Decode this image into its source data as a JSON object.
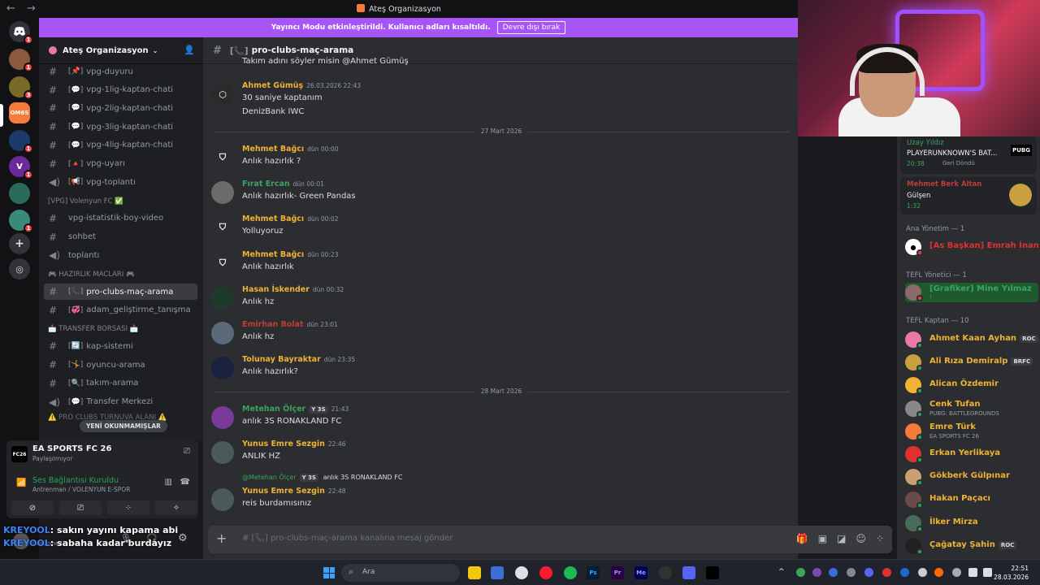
{
  "window": {
    "title": "Ateş Organizasyon",
    "back": "←",
    "forward": "→"
  },
  "banner": {
    "text": "Yayıncı Modu etkinleştirildi. Kullanıcı adları kısaltıldı.",
    "button": "Devre dışı bırak"
  },
  "guilds": [
    {
      "badge": "1"
    },
    {
      "badge": "1"
    },
    {
      "badge": "3"
    },
    {
      "label": "OM6S"
    },
    {
      "badge": "1"
    },
    {
      "badge": "1"
    },
    {
      "badge": ""
    },
    {
      "badge": "1"
    }
  ],
  "server": {
    "name": "Ateş Organizasyon"
  },
  "channels": [
    {
      "emoji": "[📌]",
      "name": "vpg-duyuru",
      "type": "announce"
    },
    {
      "emoji": "[💬]",
      "name": "vpg-1lig-kaptan-chati",
      "type": "text"
    },
    {
      "emoji": "[💬]",
      "name": "vpg-2lig-kaptan-chati",
      "type": "text"
    },
    {
      "emoji": "[💬]",
      "name": "vpg-3lig-kaptan-chati",
      "type": "text"
    },
    {
      "emoji": "[💬]",
      "name": "vpg-4lig-kaptan-chati",
      "type": "text"
    },
    {
      "emoji": "[🔺]",
      "name": "vpg-uyarı",
      "type": "text"
    },
    {
      "emoji": "[📢]",
      "name": "vpg-toplantı",
      "type": "voice"
    }
  ],
  "category1": "[VPG] Volenyun FC ✅",
  "channels2": [
    {
      "name": "vpg-istatistik-boy-video",
      "type": "text"
    },
    {
      "name": "sohbet",
      "type": "text"
    },
    {
      "name": "toplantı",
      "type": "voice"
    }
  ],
  "category2": "🎮 HAZIRLIK MACLARI 🎮",
  "channels3": [
    {
      "emoji": "[📞]",
      "name": "pro-clubs-maç-arama",
      "type": "text"
    },
    {
      "emoji": "[💞]",
      "name": "adam_geliştirme_tanışma",
      "type": "text"
    }
  ],
  "category3": "📩 TRANSFER BORSASI 📩",
  "channels4": [
    {
      "emoji": "[🔄]",
      "name": "kap-sistemi",
      "type": "text"
    },
    {
      "emoji": "[🤸]",
      "name": "oyuncu-arama",
      "type": "text"
    },
    {
      "emoji": "[🔍]",
      "name": "takım-arama",
      "type": "text"
    },
    {
      "emoji": "[💬]",
      "name": "Transfer Merkezi",
      "type": "voice"
    }
  ],
  "category4": "⚠️ PRO CLUBS TURNUVA ALANI ⚠️",
  "unread": "YENİ OKUNMAMIŞLAR",
  "panel": {
    "game": "EA SPORTS FC 26",
    "game_status": "Paylaşılmıyor",
    "game_logo": "FC26",
    "voice": "Ses Bağlantısı Kuruldu",
    "voice_sub": "Antrenman / VOLENYUN E-SPOR",
    "user_status": "Görünmez"
  },
  "overlay": [
    {
      "user": "KREYOOL",
      "text": ": sakın yayını kapama abi"
    },
    {
      "user": "KREYOOL",
      "text": ": sabaha kadar burdayız"
    }
  ],
  "channel_header": {
    "name": "pro-clubs-maç-arama",
    "emoji": "[📞]"
  },
  "messages": {
    "top_partial": "Takım adını söyler misin @Ahmet Gümüş",
    "m1": {
      "name": "Ahmet Gümüş",
      "time": "26.03.2026 22:43",
      "text": "30 saniye kaptanım",
      "text2": "DenizBank IWC",
      "color": "#f0b232"
    },
    "sep1": "27 Mart 2026",
    "m2": {
      "name": "Mehmet Bağcı",
      "time": "dün 00:00",
      "text": "Anlık hazırlık ?",
      "color": "#f0b232"
    },
    "m3": {
      "name": "Fırat Ercan",
      "time": "dün 00:01",
      "text": "Anlık hazırlık- Green Pandas",
      "color": "#3ba55d"
    },
    "m4": {
      "name": "Mehmet Bağcı",
      "time": "dün 00:02",
      "text": "Yolluyoruz",
      "color": "#f0b232"
    },
    "m5": {
      "name": "Mehmet Bağcı",
      "time": "dün 00:23",
      "text": "Anlık hazırlık",
      "color": "#f0b232"
    },
    "m6": {
      "name": "Hasan İskender",
      "time": "dün 00:32",
      "text": "Anlık hz",
      "color": "#f0b232"
    },
    "m7": {
      "name": "Emirhan Bolat",
      "time": "dün 23:01",
      "text": "Anlık hz",
      "color": "#c23b3b"
    },
    "m8": {
      "name": "Tolunay Bayraktar",
      "time": "dün 23:35",
      "text": "Anlık hazırlık?",
      "color": "#f0b232"
    },
    "sep2": "28 Mart 2026",
    "m9": {
      "name": "Metehan Ölçer",
      "tag": "Y 3S",
      "time": "21:43",
      "text": "anlık 3S RONAKLAND FC",
      "color": "#3ba55d"
    },
    "m10": {
      "name": "Yunus Emre Sezgin",
      "time": "22:46",
      "text": "ANLIK HZ",
      "color": "#f0b232"
    },
    "reply": {
      "name": "@Metehan Ölçer",
      "tag": "Y 3S",
      "text": "anlık 3S RONAKLAND FC"
    },
    "m11": {
      "name": "Yunus Emre Sezgin",
      "time": "22:48",
      "text": "reis burdamısınız",
      "color": "#f0b232"
    }
  },
  "composer": {
    "placeholder": "# [📞] pro-clubs-maç-arama kanalına mesaj gönder"
  },
  "members": {
    "card1": {
      "name": "Uzay Yıldız",
      "game": "PLAYERUNKNOWN'S BAT...",
      "meta": "20:38",
      "meta2": "Geri Döndü",
      "logo": "PUBG"
    },
    "card2": {
      "name": "Mehmet Berk Altan",
      "song": "Gülşen",
      "time": "1:32"
    },
    "cat1": "Ana Yönetim — 1",
    "u1": {
      "name": "[As Başkan] Emrah İnan",
      "color": "#e03131"
    },
    "cat2": "TEFL Yönetici — 1",
    "u2": {
      "name": "[Grafiker] Mine Yılmaz",
      "sub": "!",
      "color": "#3ba55d"
    },
    "cat3": "TEFL Kaptan — 10",
    "kaptan": [
      {
        "name": "Ahmet Kaan Ayhan",
        "tag": "ROC",
        "sub": ""
      },
      {
        "name": "Ali Rıza Demiralp",
        "tag": "BRFC",
        "sub": ""
      },
      {
        "name": "Alican Özdemir",
        "tag": "",
        "sub": ""
      },
      {
        "name": "Cenk Tufan",
        "tag": "",
        "sub": "PUBG: BATTLEGROUNDS"
      },
      {
        "name": "Emre Türk",
        "tag": "",
        "sub": "EA SPORTS FC 26"
      },
      {
        "name": "Erkan Yerlikaya",
        "tag": "",
        "sub": ""
      },
      {
        "name": "Gökberk Gülpınar",
        "tag": "",
        "sub": ""
      },
      {
        "name": "Hakan Paçacı",
        "tag": "",
        "sub": ""
      },
      {
        "name": "İlker Mirza",
        "tag": "",
        "sub": ""
      },
      {
        "name": "Çağatay Şahin",
        "tag": "ROC",
        "sub": ""
      }
    ],
    "kaptan_color": "#f0b232"
  },
  "taskbar": {
    "search": "Ara",
    "time": "22:51",
    "date": "28.03.2026"
  }
}
